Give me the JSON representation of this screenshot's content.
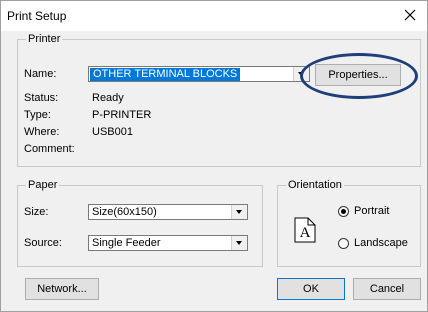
{
  "window": {
    "title": "Print Setup"
  },
  "printer": {
    "group_label": "Printer",
    "name_label": "Name:",
    "name_value": "OTHER TERMINAL BLOCKS",
    "properties_label": "Properties...",
    "status_label": "Status:",
    "status_value": "Ready",
    "type_label": "Type:",
    "type_value": "P-PRINTER",
    "where_label": "Where:",
    "where_value": "USB001",
    "comment_label": "Comment:",
    "comment_value": ""
  },
  "paper": {
    "group_label": "Paper",
    "size_label": "Size:",
    "size_value": "Size(60x150)",
    "source_label": "Source:",
    "source_value": "Single Feeder"
  },
  "orientation": {
    "group_label": "Orientation",
    "page_glyph": "A",
    "options": [
      {
        "label": "Portrait",
        "selected": true
      },
      {
        "label": "Landscape",
        "selected": false
      }
    ]
  },
  "buttons": {
    "network_label": "Network...",
    "ok_label": "OK",
    "cancel_label": "Cancel"
  },
  "colors": {
    "selection": "#0078d7",
    "annotation_oval": "#1f3f7a"
  },
  "icons": [
    "close-icon",
    "dropdown-arrow-icon",
    "portrait-page-icon",
    "radio-icon"
  ]
}
